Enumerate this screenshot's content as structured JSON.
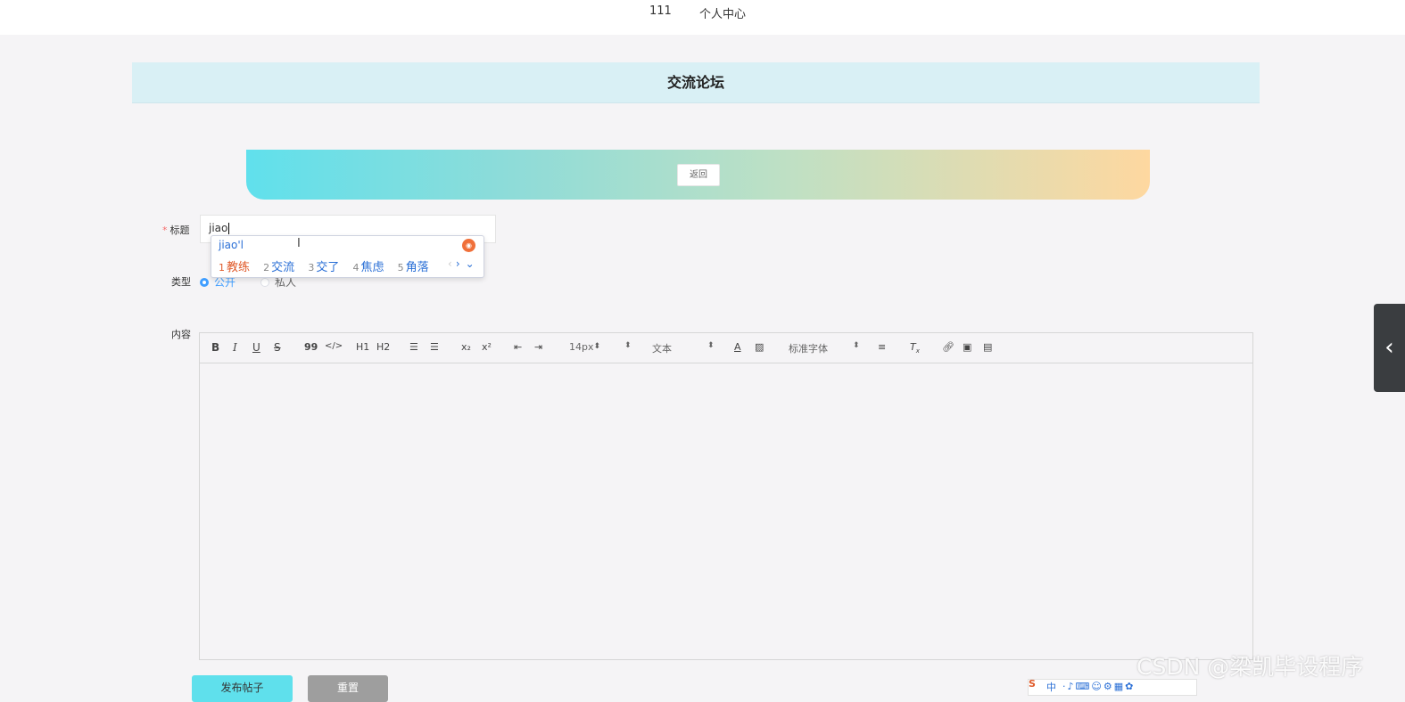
{
  "header": {
    "username": "111",
    "personal_center": "个人中心"
  },
  "page": {
    "title": "交流论坛"
  },
  "banner": {
    "back_label": "返回"
  },
  "form": {
    "title_label": "标题",
    "title_required_mark": "*",
    "title_value": "jiao",
    "type_label": "类型",
    "type_options": [
      "公开",
      "私人"
    ],
    "type_selected": "公开",
    "content_label": "内容"
  },
  "ime_popup": {
    "pinyin": "jiao'l",
    "candidates": [
      {
        "num": "1",
        "text": "教练"
      },
      {
        "num": "2",
        "text": "交流"
      },
      {
        "num": "3",
        "text": "交了"
      },
      {
        "num": "4",
        "text": "焦虑"
      },
      {
        "num": "5",
        "text": "角落"
      }
    ],
    "prev": "‹",
    "next": "›",
    "expand": "⌄"
  },
  "editor_toolbar": {
    "bold": "B",
    "italic": "I",
    "underline": "U",
    "strike": "S",
    "blockquote": "99",
    "code": "</>",
    "h1": "H1",
    "h2": "H2",
    "subscript": "x₂",
    "superscript": "x²",
    "font_size": "14px",
    "text_style": "文本",
    "font_family": "标准字体"
  },
  "buttons": {
    "submit": "发布帖子",
    "reset": "重置"
  },
  "side_tab": {
    "icon": "‹"
  },
  "watermark": "CSDN @梁凯毕设程序",
  "ime_tray": {
    "logo": "S",
    "mode": "中"
  },
  "colors": {
    "accent": "#409eff",
    "submit_bg": "#5fe0ec",
    "reset_bg": "#9e9e9e",
    "title_bar_bg": "#d9f0f5",
    "banner_gradient_start": "#60e0ec",
    "banner_gradient_end": "#fed8a0"
  }
}
